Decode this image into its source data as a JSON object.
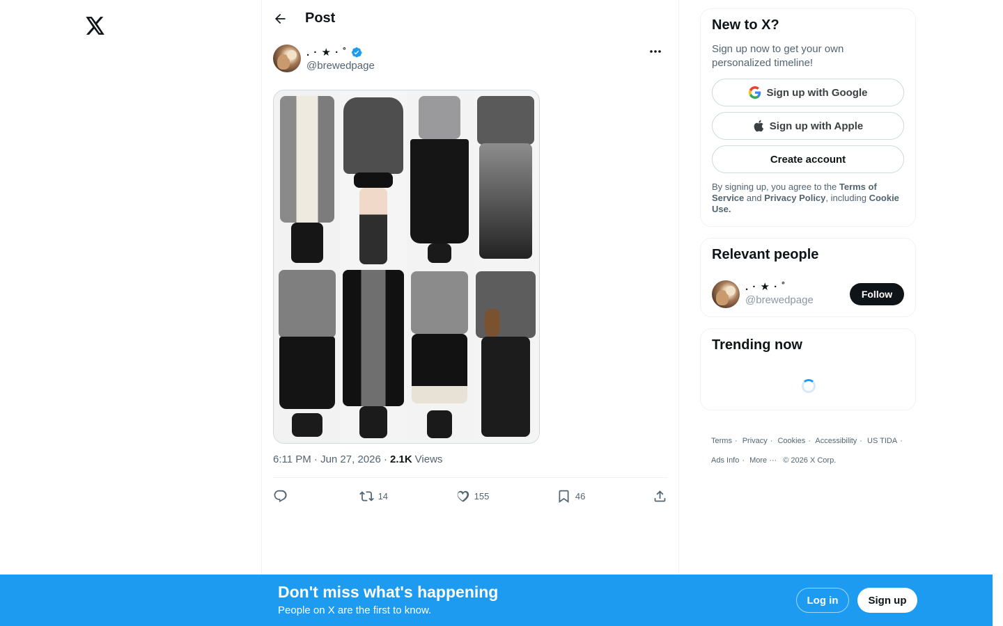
{
  "app": {
    "logo_icon": "x-logo-icon"
  },
  "topbar": {
    "title": "Post"
  },
  "post": {
    "author": {
      "display_name": ". · ★ ·   ˚",
      "handle": "@brewedpage",
      "verified": true
    },
    "media_alt": "outfit-collage",
    "time": "6:11 PM · Jun 27, 2026 ·",
    "views_count": "2.1K",
    "views_label": "Views",
    "stats": {
      "replies": "",
      "reposts": "14",
      "likes": "155",
      "bookmarks": "46"
    }
  },
  "signup_card": {
    "title": "New to X?",
    "subtitle": "Sign up now to get your own personalized timeline!",
    "google_label": "Sign up with Google",
    "apple_label": "Sign up with Apple",
    "create_label": "Create account",
    "legal_prefix": "By signing up, you agree to the",
    "terms": "Terms of Service",
    "and": "and",
    "privacy": "Privacy Policy",
    "including": ", including",
    "cookie": "Cookie Use."
  },
  "relevant_people": {
    "title": "Relevant people",
    "person": {
      "display_name": ". · ★ ·   ˚",
      "handle": "@brewedpage",
      "follow_label": "Follow"
    }
  },
  "trending": {
    "title": "Trending now"
  },
  "footer": {
    "links": [
      "Terms",
      "Privacy",
      "Cookies",
      "Accessibility",
      "US TIDA",
      "Ads Info",
      "More ···"
    ],
    "copyright": "© 2026 X Corp."
  },
  "banner": {
    "title": "Don't miss what's happening",
    "subtitle": "People on X are the first to know.",
    "login_label": "Log in",
    "signup_label": "Sign up"
  },
  "colors": {
    "accent": "#1d9bf0",
    "text": "#0f1419",
    "muted": "#536471"
  }
}
